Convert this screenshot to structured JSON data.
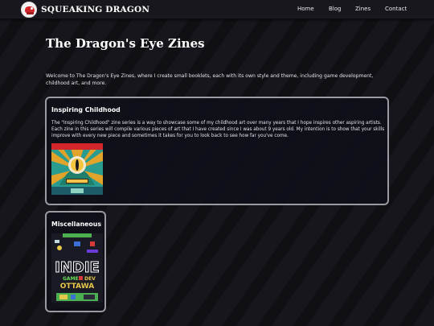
{
  "header": {
    "brand": "SQUEAKING DRAGON",
    "nav": [
      "Home",
      "Blog",
      "Zines",
      "Contact"
    ]
  },
  "page": {
    "title": "The Dragon's Eye Zines",
    "intro": "Welcome to The Dragon's Eye Zines, where I create small booklets, each with its own style and theme, including game development, childhood art, and more."
  },
  "sections": [
    {
      "title": "Inspiring Childhood",
      "text": "The \"Inspiring Childhood\" zine series is a way to showcase some of my childhood art over many years that I hope inspires other aspiring artists. Each zine in this series will compile various pieces of art that I have created since I was about 9 years old. My intention is to show that your skills improve with every new piece and sometimes it takes for you to look back to see how far you've come.",
      "cover": "dragon-eye-cover-image"
    },
    {
      "title": "Miscellaneous",
      "cover": "indie-game-dev-ottawa-cover-image",
      "cover_text": [
        "INDIE",
        "GAME",
        "DEV",
        "OTTAWA"
      ]
    }
  ],
  "colors": {
    "background": "#16161c",
    "card_border": "#9a9aa2",
    "text": "#e8e8ee"
  }
}
